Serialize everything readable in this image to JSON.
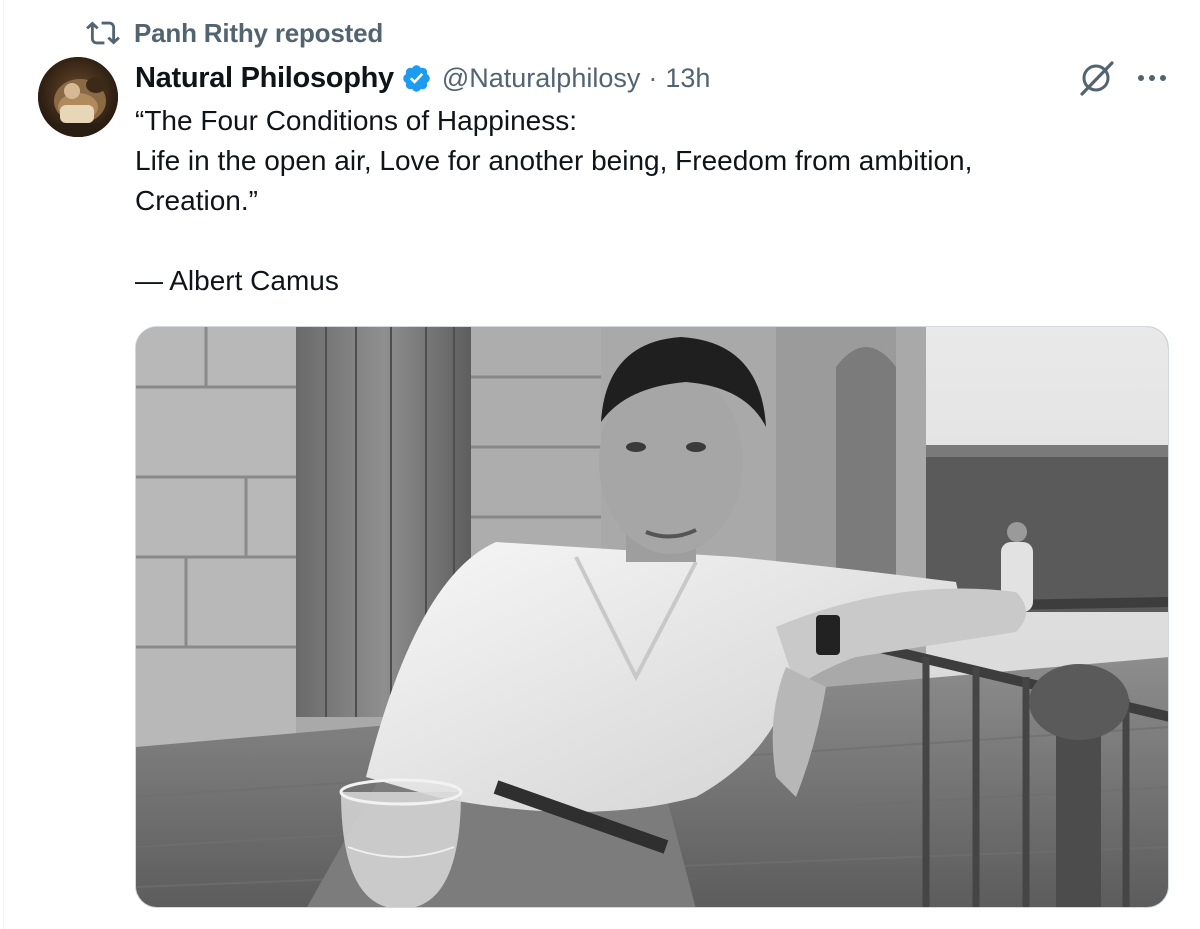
{
  "repost": {
    "icon": "repost-icon",
    "text": "Panh Rithy reposted"
  },
  "tweet": {
    "author_name": "Natural Philosophy",
    "verified": true,
    "verified_color": "#1d9bf0",
    "handle": "@Naturalphilosy",
    "separator": "·",
    "time": "13h",
    "text_lines": [
      "“The Four Conditions of Happiness:",
      "Life in the open air, Love for another being, Freedom from ambition,",
      "Creation.”",
      "",
      "— Albert Camus"
    ],
    "actions": {
      "grok_icon": "grok-icon",
      "more_icon": "more-options-icon"
    },
    "media": {
      "type": "photo",
      "style": "black-and-white"
    }
  },
  "colors": {
    "text_primary": "#0f1419",
    "text_secondary": "#536471",
    "border": "#cfd9de"
  }
}
